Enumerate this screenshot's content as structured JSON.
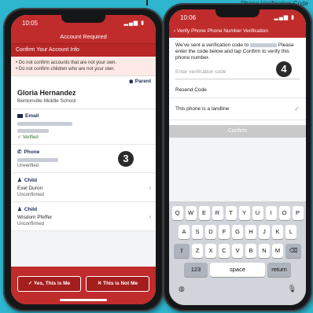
{
  "caption": "Phone Verification Code",
  "left": {
    "time": "10:05",
    "title": "Account Required",
    "subtitle": "Confirm Your Account Info",
    "warnings": [
      "• Do not confirm accounts that are not your own.",
      "• Do not confirm children who are not your own."
    ],
    "role": "Parent",
    "name": "Gloria Hernandez",
    "school": "Bentonville Middle School",
    "email_label": "Email",
    "email_status": "✓ Verified",
    "phone_label": "Phone",
    "phone_status": "Unverified",
    "child1_label": "Child",
    "child1_name": "Exel Duron",
    "child1_status": "Unconfirmed",
    "child2_label": "Child",
    "child2_name": "Wisdom Pfeffer",
    "child2_status": "Unconfirmed",
    "btn_yes": "✓ Yes, This is Me",
    "btn_no": "✕ This is Not Me",
    "step": "3"
  },
  "right": {
    "time": "10:06",
    "nav_title": "‹ Verify Phone  Phone Number Verification",
    "intro_a": "We've sent a verification code to",
    "intro_b": "Please enter the code below and tap Confirm to verify this phone number.",
    "code_placeholder": "Enter verification code",
    "resend": "Resend Code",
    "landline": "This phone is a landline",
    "confirm": "Confirm",
    "step": "4",
    "keys_row1": [
      "Q",
      "W",
      "E",
      "R",
      "T",
      "Y",
      "U",
      "I",
      "O",
      "P"
    ],
    "keys_row2": [
      "A",
      "S",
      "D",
      "F",
      "G",
      "H",
      "J",
      "K",
      "L"
    ],
    "keys_row3": [
      "Z",
      "X",
      "C",
      "V",
      "B",
      "N",
      "M"
    ],
    "key_numbers": "123",
    "key_space": "space",
    "key_return": "return"
  }
}
